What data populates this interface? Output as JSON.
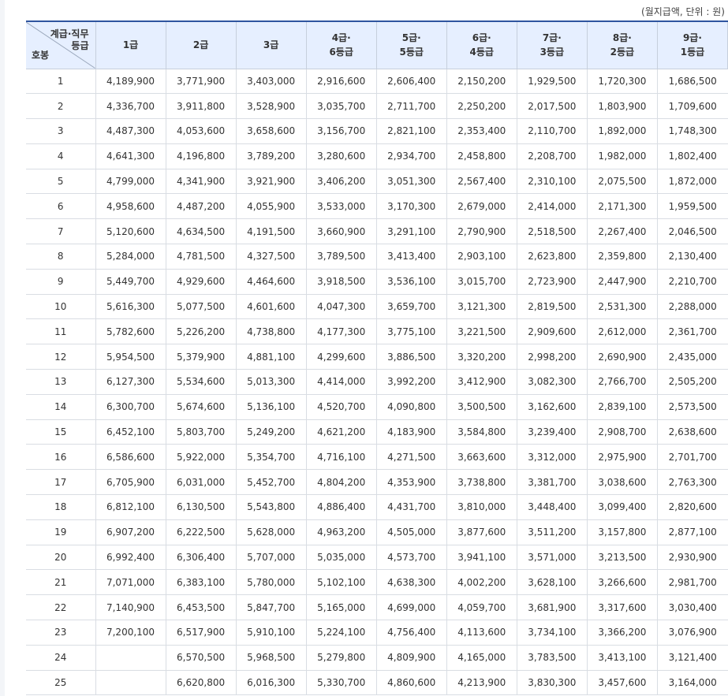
{
  "unit_note": "(월지급액, 단위 : 원)",
  "header": {
    "corner_top_1": "계급·직무",
    "corner_top_2": "등급",
    "corner_bottom": "호봉",
    "columns": [
      {
        "line1": "1급",
        "line2": ""
      },
      {
        "line1": "2급",
        "line2": ""
      },
      {
        "line1": "3급",
        "line2": ""
      },
      {
        "line1": "4급·",
        "line2": "6등급"
      },
      {
        "line1": "5급·",
        "line2": "5등급"
      },
      {
        "line1": "6급·",
        "line2": "4등급"
      },
      {
        "line1": "7급·",
        "line2": "3등급"
      },
      {
        "line1": "8급·",
        "line2": "2등급"
      },
      {
        "line1": "9급·",
        "line2": "1등급"
      }
    ]
  },
  "rows": [
    {
      "step": "1",
      "values": [
        "4,189,900",
        "3,771,900",
        "3,403,000",
        "2,916,600",
        "2,606,400",
        "2,150,200",
        "1,929,500",
        "1,720,300",
        "1,686,500"
      ]
    },
    {
      "step": "2",
      "values": [
        "4,336,700",
        "3,911,800",
        "3,528,900",
        "3,035,700",
        "2,711,700",
        "2,250,200",
        "2,017,500",
        "1,803,900",
        "1,709,600"
      ]
    },
    {
      "step": "3",
      "values": [
        "4,487,300",
        "4,053,600",
        "3,658,600",
        "3,156,700",
        "2,821,100",
        "2,353,400",
        "2,110,700",
        "1,892,000",
        "1,748,300"
      ]
    },
    {
      "step": "4",
      "values": [
        "4,641,300",
        "4,196,800",
        "3,789,200",
        "3,280,600",
        "2,934,700",
        "2,458,800",
        "2,208,700",
        "1,982,000",
        "1,802,400"
      ]
    },
    {
      "step": "5",
      "values": [
        "4,799,000",
        "4,341,900",
        "3,921,900",
        "3,406,200",
        "3,051,300",
        "2,567,400",
        "2,310,100",
        "2,075,500",
        "1,872,000"
      ]
    },
    {
      "step": "6",
      "values": [
        "4,958,600",
        "4,487,200",
        "4,055,900",
        "3,533,000",
        "3,170,300",
        "2,679,000",
        "2,414,000",
        "2,171,300",
        "1,959,500"
      ]
    },
    {
      "step": "7",
      "values": [
        "5,120,600",
        "4,634,500",
        "4,191,500",
        "3,660,900",
        "3,291,100",
        "2,790,900",
        "2,518,500",
        "2,267,400",
        "2,046,500"
      ]
    },
    {
      "step": "8",
      "values": [
        "5,284,000",
        "4,781,500",
        "4,327,500",
        "3,789,500",
        "3,413,400",
        "2,903,100",
        "2,623,800",
        "2,359,800",
        "2,130,400"
      ]
    },
    {
      "step": "9",
      "values": [
        "5,449,700",
        "4,929,600",
        "4,464,600",
        "3,918,500",
        "3,536,100",
        "3,015,700",
        "2,723,900",
        "2,447,900",
        "2,210,700"
      ]
    },
    {
      "step": "10",
      "values": [
        "5,616,300",
        "5,077,500",
        "4,601,600",
        "4,047,300",
        "3,659,700",
        "3,121,300",
        "2,819,500",
        "2,531,300",
        "2,288,000"
      ]
    },
    {
      "step": "11",
      "values": [
        "5,782,600",
        "5,226,200",
        "4,738,800",
        "4,177,300",
        "3,775,100",
        "3,221,500",
        "2,909,600",
        "2,612,000",
        "2,361,700"
      ]
    },
    {
      "step": "12",
      "values": [
        "5,954,500",
        "5,379,900",
        "4,881,100",
        "4,299,600",
        "3,886,500",
        "3,320,200",
        "2,998,200",
        "2,690,900",
        "2,435,000"
      ]
    },
    {
      "step": "13",
      "values": [
        "6,127,300",
        "5,534,600",
        "5,013,300",
        "4,414,000",
        "3,992,200",
        "3,412,900",
        "3,082,300",
        "2,766,700",
        "2,505,200"
      ]
    },
    {
      "step": "14",
      "values": [
        "6,300,700",
        "5,674,600",
        "5,136,100",
        "4,520,700",
        "4,090,800",
        "3,500,500",
        "3,162,600",
        "2,839,100",
        "2,573,500"
      ]
    },
    {
      "step": "15",
      "values": [
        "6,452,100",
        "5,803,700",
        "5,249,200",
        "4,621,200",
        "4,183,900",
        "3,584,800",
        "3,239,400",
        "2,908,700",
        "2,638,600"
      ]
    },
    {
      "step": "16",
      "values": [
        "6,586,600",
        "5,922,000",
        "5,354,700",
        "4,716,100",
        "4,271,500",
        "3,663,600",
        "3,312,000",
        "2,975,900",
        "2,701,700"
      ]
    },
    {
      "step": "17",
      "values": [
        "6,705,900",
        "6,031,000",
        "5,452,700",
        "4,804,200",
        "4,353,900",
        "3,738,800",
        "3,381,700",
        "3,038,600",
        "2,763,300"
      ]
    },
    {
      "step": "18",
      "values": [
        "6,812,100",
        "6,130,500",
        "5,543,800",
        "4,886,400",
        "4,431,700",
        "3,810,000",
        "3,448,400",
        "3,099,400",
        "2,820,600"
      ]
    },
    {
      "step": "19",
      "values": [
        "6,907,200",
        "6,222,500",
        "5,628,000",
        "4,963,200",
        "4,505,000",
        "3,877,600",
        "3,511,200",
        "3,157,800",
        "2,877,100"
      ]
    },
    {
      "step": "20",
      "values": [
        "6,992,400",
        "6,306,400",
        "5,707,000",
        "5,035,000",
        "4,573,700",
        "3,941,100",
        "3,571,000",
        "3,213,500",
        "2,930,900"
      ]
    },
    {
      "step": "21",
      "values": [
        "7,071,000",
        "6,383,100",
        "5,780,000",
        "5,102,100",
        "4,638,300",
        "4,002,200",
        "3,628,100",
        "3,266,600",
        "2,981,700"
      ]
    },
    {
      "step": "22",
      "values": [
        "7,140,900",
        "6,453,500",
        "5,847,700",
        "5,165,000",
        "4,699,000",
        "4,059,700",
        "3,681,900",
        "3,317,600",
        "3,030,400"
      ]
    },
    {
      "step": "23",
      "values": [
        "7,200,100",
        "6,517,900",
        "5,910,100",
        "5,224,100",
        "4,756,400",
        "4,113,600",
        "3,734,100",
        "3,366,200",
        "3,076,900"
      ]
    },
    {
      "step": "24",
      "values": [
        "",
        "6,570,500",
        "5,968,500",
        "5,279,800",
        "4,809,900",
        "4,165,000",
        "3,783,500",
        "3,413,100",
        "3,121,400"
      ]
    },
    {
      "step": "25",
      "values": [
        "",
        "6,620,800",
        "6,016,300",
        "5,330,700",
        "4,860,600",
        "4,213,900",
        "3,830,300",
        "3,457,600",
        "3,164,000"
      ]
    }
  ]
}
